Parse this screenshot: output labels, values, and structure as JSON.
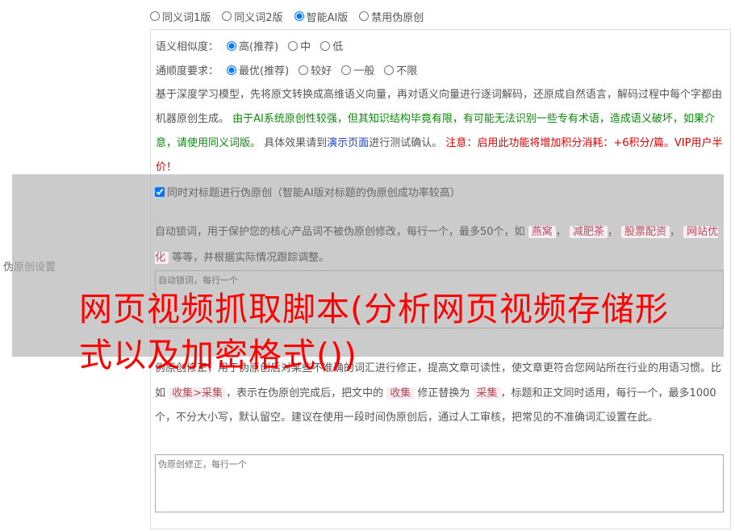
{
  "version_options": [
    {
      "label": "同义词1版",
      "checked": false
    },
    {
      "label": "同义词2版",
      "checked": false
    },
    {
      "label": "智能AI版",
      "checked": true
    },
    {
      "label": "禁用伪原创",
      "checked": false
    }
  ],
  "left_label": "伪原创设置",
  "similarity": {
    "label": "语义相似度：",
    "options": [
      "高(推荐)",
      "中",
      "低"
    ],
    "selected": 0
  },
  "fluency": {
    "label": "通顺度要求：",
    "options": [
      "最优(推荐)",
      "较好",
      "一般",
      "不限"
    ],
    "selected": 0
  },
  "description": {
    "part1": "基于深度学习模型，先将原文转换成高维语义向量，再对语义向量进行逐词解码，还原成自然语言，解码过程中每个字都由机器原创生成。",
    "green": "由于AI系统原创性较强，但其知识结构毕竟有限，有可能无法识别一些专有术语，造成语义破坏，如果介意，请使用同义词版。",
    "part2": "具体效果请到",
    "link": "演示页面",
    "part3": "进行测试确认。",
    "red": "注意：启用此功能将增加积分消耗：+6积分/篇。VIP用户半价！"
  },
  "title_checkbox": {
    "label": "同时对标题进行伪原创（智能AI版对标题的伪原创成功率较高）",
    "checked": true
  },
  "lock_words": {
    "desc_a": "自动锁词，用于保护您的核心产品词不被伪原创修改，每行一个，最多50个，如",
    "examples": [
      "燕窝",
      "减肥茶",
      "股票配资",
      "网站优化"
    ],
    "desc_b": "等等，并根据实际情况跟踪调整。",
    "placeholder": "自动锁词，每行一个"
  },
  "fix_words": {
    "desc_a": "伪原创修正，用于伪原创后对某些不准确的词汇进行修正，提高文章可读性，使文章更符合您网站所在行业的用语习惯。比如",
    "example1": "收集>采集",
    "desc_b": "，表示在伪原创完成后，把文中的",
    "example2": "收集",
    "desc_c": "修正替换为",
    "example3": "采集",
    "desc_d": "，标题和正文同时适用，每行一个，最多1000个，不分大小写，默认留空。建议在使用一段时间伪原创后，通过人工审核，把常见的不准确词汇设置在此。",
    "placeholder": "伪原创修正，每行一个"
  },
  "watermark": "网页视频抓取脚本(分析网页视频存储形式以及加密格式())"
}
